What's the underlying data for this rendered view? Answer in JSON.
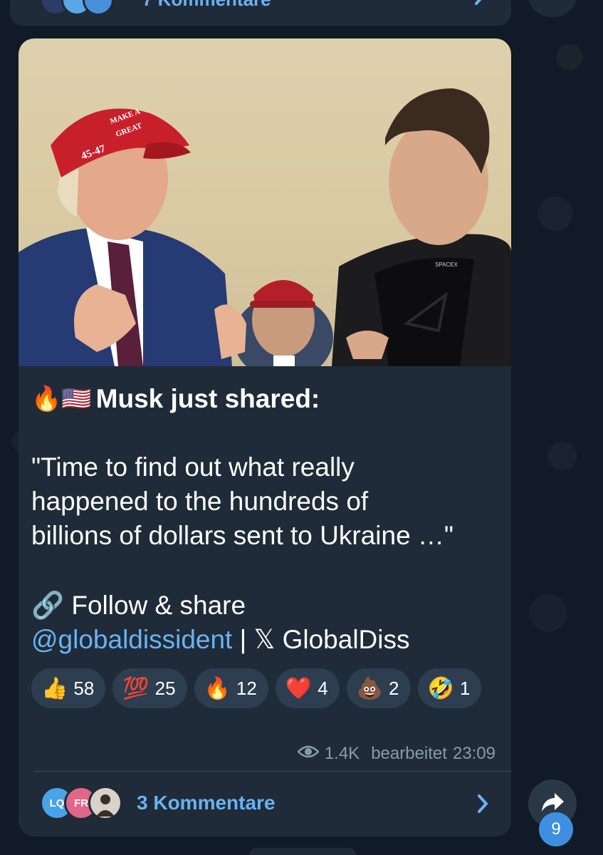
{
  "previous_message": {
    "comments_label": "7 Kommentare"
  },
  "post": {
    "title_emojis": "🔥🇺🇸",
    "title": "Musk just shared:",
    "quote_line1": "\"Time to find out what really",
    "quote_line2": "happened to the hundreds of",
    "quote_line3": "billions of dollars sent to Ukraine …\"",
    "follow_emoji": "🔗",
    "follow_text": "Follow & share",
    "channel_handle": "@globaldissident",
    "separator": " | ",
    "x_handle": "𝕏 GlobalDiss",
    "photo_cap_text_1": "45-47",
    "photo_cap_text_2": "MAKE A",
    "photo_cap_text_3": "GREAT",
    "photo_shirt_text": "SPACEX"
  },
  "reactions": [
    {
      "emoji": "👍",
      "count": "58"
    },
    {
      "emoji": "💯",
      "count": "25"
    },
    {
      "emoji": "🔥",
      "count": "12"
    },
    {
      "emoji": "❤️",
      "count": "4"
    },
    {
      "emoji": "💩",
      "count": "2"
    },
    {
      "emoji": "🤣",
      "count": "1"
    }
  ],
  "meta": {
    "views": "1.4K",
    "edited_label": "bearbeitet",
    "time": "23:09"
  },
  "comments": {
    "avatars": [
      "LQ",
      "FR",
      ""
    ],
    "label": "3 Kommentare"
  },
  "share": {
    "count": "9"
  },
  "colors": {
    "accent": "#6ab2f2",
    "bubble": "#1f2b38",
    "background": "#101b27",
    "badge": "#3e8fe0"
  }
}
